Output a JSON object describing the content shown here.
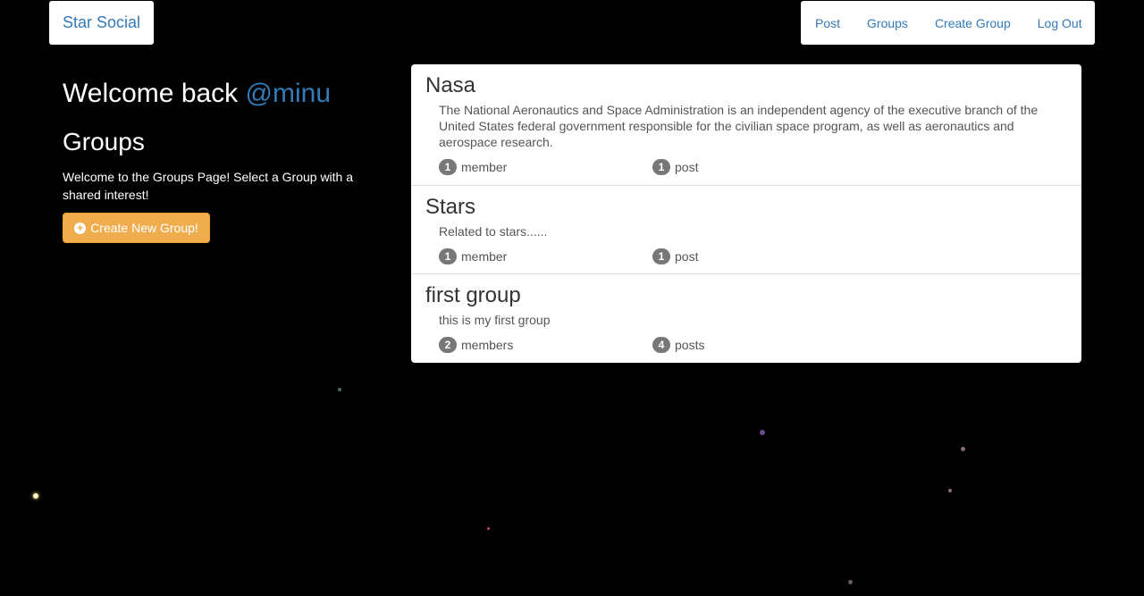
{
  "navbar": {
    "brand": "Star Social",
    "links": [
      "Post",
      "Groups",
      "Create Group",
      "Log Out"
    ]
  },
  "sidebar": {
    "welcome_text": "Welcome back ",
    "username": "@minu",
    "heading": "Groups",
    "intro": "Welcome to the Groups Page! Select a Group with a shared interest!",
    "create_button_label": "Create New Group!"
  },
  "groups": [
    {
      "name": "Nasa",
      "description": "The National Aeronautics and Space Administration is an independent agency of the executive branch of the United States federal government responsible for the civilian space program, as well as aeronautics and aerospace research.",
      "member_count": "1",
      "member_label": "member",
      "post_count": "1",
      "post_label": "post"
    },
    {
      "name": "Stars",
      "description": "Related to stars......",
      "member_count": "1",
      "member_label": "member",
      "post_count": "1",
      "post_label": "post"
    },
    {
      "name": "first group",
      "description": "this is my first group",
      "member_count": "2",
      "member_label": "members",
      "post_count": "4",
      "post_label": "posts"
    }
  ],
  "colors": {
    "background": "#000000",
    "link": "#337ab7",
    "warning_button": "#f0ad4e",
    "badge": "#777777"
  }
}
